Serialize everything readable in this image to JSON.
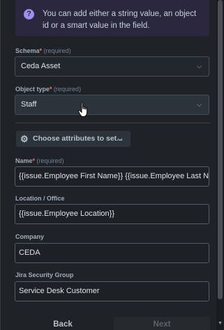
{
  "info": {
    "text": "You can add either a string value, an object id or a smart value in the field.",
    "icon": "help-icon",
    "icon_glyph": "?"
  },
  "schema": {
    "label": "Schema",
    "required_star": "*",
    "required_text": "(required)",
    "value": "Ceda Asset"
  },
  "object_type": {
    "label": "Object type",
    "required_star": "*",
    "required_text": "(required)",
    "value": "Staff"
  },
  "attributes_button": {
    "label": "Choose attributes to set...",
    "icon": "gear-icon"
  },
  "fields": {
    "name": {
      "label": "Name",
      "required_star": "*",
      "required_text": "(required)",
      "value": "{{issue.Employee First Name}} {{issue.Employee Last Name}}"
    },
    "location": {
      "label": "Location / Office",
      "value": "{{issue.Employee Location}}"
    },
    "company": {
      "label": "Company",
      "value": "CEDA"
    },
    "security_group": {
      "label": "Jira Security Group",
      "value": "Service Desk Customer"
    }
  },
  "footer": {
    "back_label": "Back",
    "next_label": "Next"
  },
  "colors": {
    "background": "#1f2226",
    "banner": "#2b273f",
    "info_icon": "#9f8fef",
    "required": "#f87168"
  }
}
